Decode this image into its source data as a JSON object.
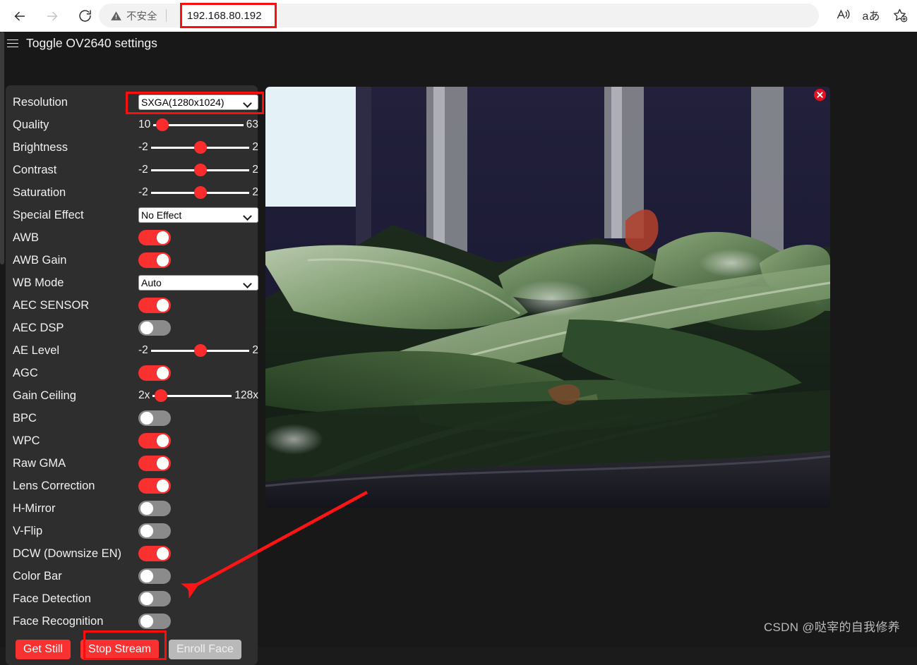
{
  "browser": {
    "back_label": "Back",
    "forward_label": "Forward",
    "reload_label": "Refresh",
    "security_text": "不安全",
    "url": "192.168.80.192",
    "read_aloud_label": "A",
    "translate_label": "aあ",
    "favorites_label": "Add to favorites"
  },
  "page": {
    "toggle_header": "Toggle OV2640 settings",
    "watermark": "CSDN @哒宰的自我修养"
  },
  "settings": {
    "rows": [
      {
        "label": "Resolution",
        "type": "select",
        "value": "SXGA(1280x1024)"
      },
      {
        "label": "Quality",
        "type": "slider",
        "min": "10",
        "max": "63",
        "pos": 10
      },
      {
        "label": "Brightness",
        "type": "slider",
        "min": "-2",
        "max": "2",
        "pos": 50
      },
      {
        "label": "Contrast",
        "type": "slider",
        "min": "-2",
        "max": "2",
        "pos": 50
      },
      {
        "label": "Saturation",
        "type": "slider",
        "min": "-2",
        "max": "2",
        "pos": 50
      },
      {
        "label": "Special Effect",
        "type": "select",
        "value": "No Effect"
      },
      {
        "label": "AWB",
        "type": "toggle",
        "on": true
      },
      {
        "label": "AWB Gain",
        "type": "toggle",
        "on": true
      },
      {
        "label": "WB Mode",
        "type": "select",
        "value": "Auto"
      },
      {
        "label": "AEC SENSOR",
        "type": "toggle",
        "on": true
      },
      {
        "label": "AEC DSP",
        "type": "toggle",
        "on": false
      },
      {
        "label": "AE Level",
        "type": "slider",
        "min": "-2",
        "max": "2",
        "pos": 50
      },
      {
        "label": "AGC",
        "type": "toggle",
        "on": true
      },
      {
        "label": "Gain Ceiling",
        "type": "slider",
        "min": "2x",
        "max": "128x",
        "pos": 10
      },
      {
        "label": "BPC",
        "type": "toggle",
        "on": false
      },
      {
        "label": "WPC",
        "type": "toggle",
        "on": true
      },
      {
        "label": "Raw GMA",
        "type": "toggle",
        "on": true
      },
      {
        "label": "Lens Correction",
        "type": "toggle",
        "on": true
      },
      {
        "label": "H-Mirror",
        "type": "toggle",
        "on": false
      },
      {
        "label": "V-Flip",
        "type": "toggle",
        "on": false
      },
      {
        "label": "DCW (Downsize EN)",
        "type": "toggle",
        "on": true
      },
      {
        "label": "Color Bar",
        "type": "toggle",
        "on": false
      },
      {
        "label": "Face Detection",
        "type": "toggle",
        "on": false
      },
      {
        "label": "Face Recognition",
        "type": "toggle",
        "on": false
      }
    ],
    "buttons": [
      {
        "label": "Get Still",
        "style": "red"
      },
      {
        "label": "Stop Stream",
        "style": "red"
      },
      {
        "label": "Enroll Face",
        "style": "grey"
      }
    ]
  },
  "stream": {
    "close_label": "Close stream",
    "alt": "Live camera stream showing green plant leaves"
  },
  "colors": {
    "accent_red": "#fa3131",
    "highlight_red": "#fd0d0d",
    "panel_bg": "#2e2e2e",
    "page_bg": "#181818"
  }
}
